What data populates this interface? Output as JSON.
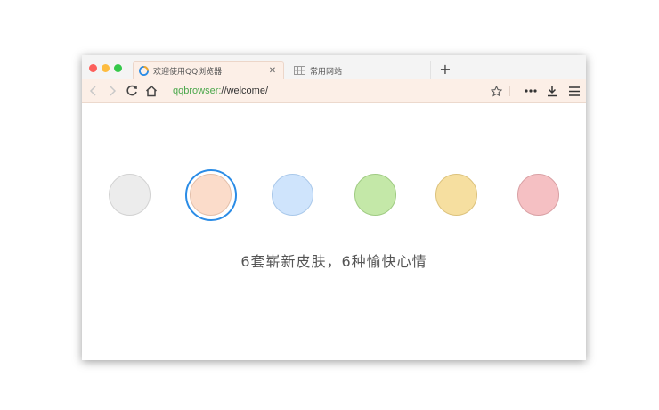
{
  "tabs": [
    {
      "label": "欢迎使用QQ浏览器",
      "icon": "qq-browser-icon",
      "active": true
    },
    {
      "label": "常用网站",
      "icon": "grid-icon",
      "active": false
    }
  ],
  "toolbar": {
    "url_scheme": "qqbrowser:",
    "url_rest": "//welcome/"
  },
  "skins": [
    {
      "name": "gray",
      "color": "#ececec",
      "border": "#d2d2d2",
      "selected": false
    },
    {
      "name": "peach",
      "color": "#fbdcca",
      "border": "#e3bfaa",
      "selected": true
    },
    {
      "name": "blue",
      "color": "#cfe4fc",
      "border": "#a9c8ea",
      "selected": false
    },
    {
      "name": "green",
      "color": "#c4e8a8",
      "border": "#9fcb82",
      "selected": false
    },
    {
      "name": "yellow",
      "color": "#f6dfa0",
      "border": "#dcc27c",
      "selected": false
    },
    {
      "name": "pink",
      "color": "#f5c0c3",
      "border": "#d9a0a4",
      "selected": false
    }
  ],
  "caption": "6套崭新皮肤，6种愉快心情",
  "colors": {
    "accent": "#2b8ce6",
    "url_scheme": "#4aa74b",
    "toolbar_bg": "#fcefe7"
  }
}
